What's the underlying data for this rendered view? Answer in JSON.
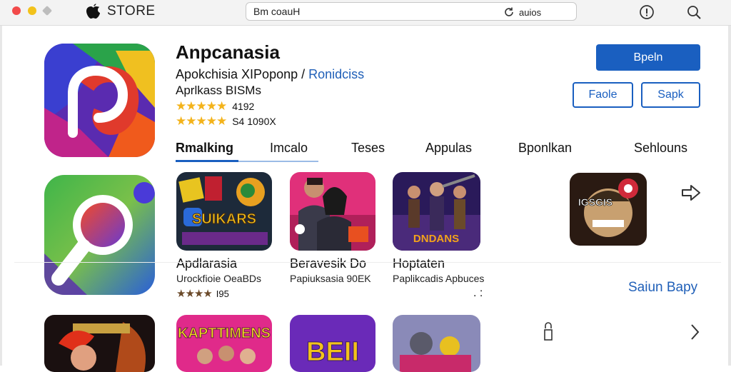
{
  "colors": {
    "accent": "#1a5fc0",
    "star": "#f3b31b",
    "tl_red": "#f24a4a",
    "tl_yellow": "#f2c21b",
    "tl_gray": "#bdbdbd"
  },
  "window": {
    "store_label": "STORE"
  },
  "search": {
    "query": "Bm coauH",
    "right_label": "auios"
  },
  "toolbar": {
    "icons": [
      "info-icon",
      "search-icon"
    ]
  },
  "app": {
    "title": "Anpcanasia",
    "subtitle_main": "Apokchisia XIPoponp /",
    "subtitle_link": "Ronidciss",
    "subtitle_2": "Aprlkass BISMs",
    "rating1_value": "4192",
    "rating2_value": "S4 1090X",
    "primary_button": "Bpeln",
    "secondary_buttons": [
      "Faole",
      "Sapk"
    ]
  },
  "tabs": [
    "Rmalking",
    "Imcalo",
    "Teses",
    "Appulas",
    "Bponlkan",
    "Sehlouns"
  ],
  "row1": [
    {
      "art_text": "SUIKARS",
      "title": "Apdlarasia",
      "subtitle": "Urockfioie OeaBDs",
      "rating": "I95"
    },
    {
      "title": "Beravesik Do",
      "subtitle": "Papiuksasia 90EK"
    },
    {
      "art_text": "DNDANS",
      "title": "Hoptaten",
      "subtitle": "Paplikcadis Apbuces"
    },
    {
      "art_text": "IGSGIS"
    }
  ],
  "row2": [
    {
      "art_text": "KAPTTIMENS"
    },
    {
      "art_text": "BEII"
    }
  ],
  "see_all": "Saiun Bapy",
  "dots": ". :"
}
